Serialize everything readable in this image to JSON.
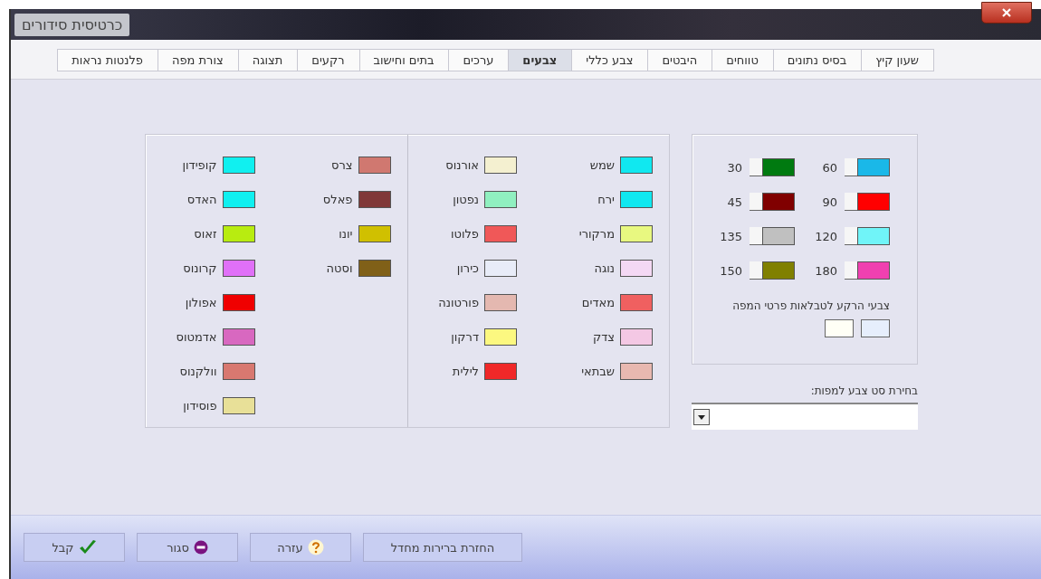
{
  "window": {
    "title": "כרטיסית סידורים"
  },
  "tabs": [
    {
      "label": "שעון קיץ",
      "selected": false
    },
    {
      "label": "בסיס נתונים",
      "selected": false
    },
    {
      "label": "טווחים",
      "selected": false
    },
    {
      "label": "היבטים",
      "selected": false
    },
    {
      "label": "צבע כללי",
      "selected": false
    },
    {
      "label": "צבעים",
      "selected": true
    },
    {
      "label": "ערכים",
      "selected": false
    },
    {
      "label": "בתים וחישוב",
      "selected": false
    },
    {
      "label": "רקעים",
      "selected": false
    },
    {
      "label": "תצוגה",
      "selected": false
    },
    {
      "label": "צורת מפה",
      "selected": false
    },
    {
      "label": "פלנטות נראות",
      "selected": false
    }
  ],
  "aspect_colors": {
    "columns": [
      [
        {
          "value": "60",
          "color": "#1ab8e8"
        },
        {
          "value": "90",
          "color": "#ff0000"
        },
        {
          "value": "120",
          "color": "#70f4f8"
        },
        {
          "value": "180",
          "color": "#f040b0"
        }
      ],
      [
        {
          "value": "30",
          "color": "#007a10"
        },
        {
          "value": "45",
          "color": "#800000"
        },
        {
          "value": "135",
          "color": "#c0c0c0"
        },
        {
          "value": "150",
          "color": "#808000"
        }
      ]
    ],
    "background_label": "צבעי הרקע לטבלאות פרטי המפה",
    "background_swatches": [
      {
        "color": "#e6eefc"
      },
      {
        "color": "#fffff6"
      }
    ]
  },
  "color_set": {
    "label": "בחירת סט צבע למפות:"
  },
  "planet_groups": [
    {
      "columns": [
        [
          {
            "name": "שמש",
            "color": "#10e8f0"
          },
          {
            "name": "ירח",
            "color": "#10e8f0"
          },
          {
            "name": "מרקורי",
            "color": "#e8f880"
          },
          {
            "name": "נוגה",
            "color": "#f4d8f4"
          },
          {
            "name": "מאדים",
            "color": "#f06060"
          },
          {
            "name": "צדק",
            "color": "#f4c8e4"
          },
          {
            "name": "שבתאי",
            "color": "#e8b8b0"
          }
        ],
        [
          {
            "name": "אורנוס",
            "color": "#f4f0d0"
          },
          {
            "name": "נפטון",
            "color": "#90f0c0"
          },
          {
            "name": "פלוטו",
            "color": "#f05858"
          },
          {
            "name": "כירון",
            "color": "#e8ecf8"
          },
          {
            "name": "פורטונה",
            "color": "#e4b8b0"
          },
          {
            "name": "דרקון",
            "color": "#fcf880"
          },
          {
            "name": "לילית",
            "color": "#f02828"
          }
        ]
      ]
    },
    {
      "columns": [
        [
          {
            "name": "צרס",
            "color": "#d07870"
          },
          {
            "name": "פאלס",
            "color": "#803838"
          },
          {
            "name": "יונו",
            "color": "#d0c000"
          },
          {
            "name": "וסטה",
            "color": "#806018"
          }
        ],
        [
          {
            "name": "קופידון",
            "color": "#10f0f0"
          },
          {
            "name": "האדס",
            "color": "#10f0f0"
          },
          {
            "name": "זאוס",
            "color": "#b8ec10"
          },
          {
            "name": "קרונוס",
            "color": "#e070f8"
          },
          {
            "name": "אפולון",
            "color": "#f00000"
          },
          {
            "name": "אדמטוס",
            "color": "#d868c0"
          },
          {
            "name": "וולקנוס",
            "color": "#d87870"
          },
          {
            "name": "פוסידון",
            "color": "#e8e098"
          }
        ]
      ]
    }
  ],
  "buttons": [
    {
      "label": "החזרת ברירות מחדל",
      "kind": "reset"
    },
    {
      "label": "עזרה",
      "kind": "help"
    },
    {
      "label": "סגור",
      "kind": "close"
    },
    {
      "label": "קבל",
      "kind": "accept"
    }
  ]
}
